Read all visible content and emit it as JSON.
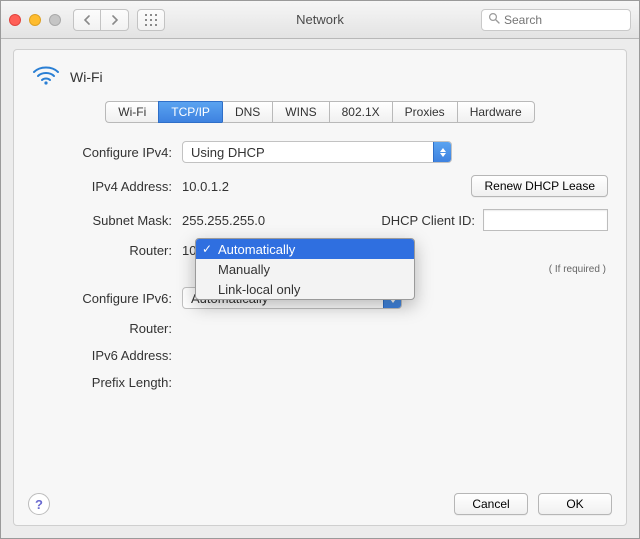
{
  "window": {
    "title": "Network",
    "search_placeholder": "Search"
  },
  "panel": {
    "interface_name": "Wi-Fi"
  },
  "tabs": [
    "Wi-Fi",
    "TCP/IP",
    "DNS",
    "WINS",
    "802.1X",
    "Proxies",
    "Hardware"
  ],
  "active_tab_index": 1,
  "ipv4": {
    "configure_label": "Configure IPv4:",
    "configure_value": "Using DHCP",
    "address_label": "IPv4 Address:",
    "address_value": "10.0.1.2",
    "subnet_label": "Subnet Mask:",
    "subnet_value": "255.255.255.0",
    "router_label": "Router:",
    "router_value": "10.0.1.1",
    "renew_button": "Renew DHCP Lease",
    "dhcp_client_id_label": "DHCP Client ID:",
    "dhcp_client_id_value": "",
    "dhcp_hint": "( If required )"
  },
  "ipv6": {
    "configure_label": "Configure IPv6:",
    "dropdown_options": [
      "Automatically",
      "Manually",
      "Link-local only"
    ],
    "selected_index": 0,
    "router_label": "Router:",
    "router_value": "",
    "address_label": "IPv6 Address:",
    "address_value": "",
    "prefix_label": "Prefix Length:",
    "prefix_value": ""
  },
  "buttons": {
    "cancel": "Cancel",
    "ok": "OK"
  }
}
